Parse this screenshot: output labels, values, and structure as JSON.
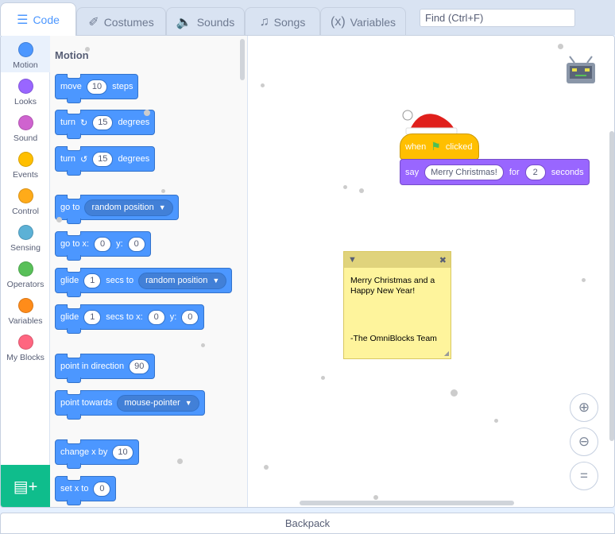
{
  "tabs": [
    {
      "label": "Code",
      "icon": "code-icon",
      "active": true
    },
    {
      "label": "Costumes",
      "icon": "brush-icon"
    },
    {
      "label": "Sounds",
      "icon": "speaker-icon"
    },
    {
      "label": "Songs",
      "icon": "music-note-icon"
    },
    {
      "label": "Variables",
      "icon": "variable-icon"
    }
  ],
  "find": {
    "placeholder": "Find (Ctrl+F)"
  },
  "categories": [
    {
      "label": "Motion",
      "color": "#4c97ff"
    },
    {
      "label": "Looks",
      "color": "#9966ff"
    },
    {
      "label": "Sound",
      "color": "#cf63cf"
    },
    {
      "label": "Events",
      "color": "#ffbf00"
    },
    {
      "label": "Control",
      "color": "#ffab19"
    },
    {
      "label": "Sensing",
      "color": "#5cb1d6"
    },
    {
      "label": "Operators",
      "color": "#59c059"
    },
    {
      "label": "Variables",
      "color": "#ff8c1a"
    },
    {
      "label": "My Blocks",
      "color": "#ff6680"
    }
  ],
  "flyout": {
    "title": "Motion",
    "blocks": {
      "move": {
        "a": "move",
        "n": "10",
        "b": "steps"
      },
      "turn_right": {
        "a": "turn",
        "n": "15",
        "b": "degrees"
      },
      "turn_left": {
        "a": "turn",
        "n": "15",
        "b": "degrees"
      },
      "goto": {
        "a": "go to",
        "dd": "random position"
      },
      "goto_xy": {
        "a": "go to x:",
        "x": "0",
        "b": "y:",
        "y": "0"
      },
      "glide_to": {
        "a": "glide",
        "n": "1",
        "b": "secs to",
        "dd": "random position"
      },
      "glide_xy": {
        "a": "glide",
        "n": "1",
        "b": "secs to x:",
        "x": "0",
        "c": "y:",
        "y": "0"
      },
      "point_dir": {
        "a": "point in direction",
        "n": "90"
      },
      "point_towards": {
        "a": "point towards",
        "dd": "mouse-pointer"
      },
      "change_x": {
        "a": "change x by",
        "n": "10"
      },
      "set_x": {
        "a": "set x to",
        "n": "0"
      }
    }
  },
  "script": {
    "hat": {
      "a": "when",
      "b": "clicked"
    },
    "say": {
      "a": "say",
      "text": "Merry Christmas!",
      "b": "for",
      "n": "2",
      "c": "seconds"
    }
  },
  "note": {
    "body": "Merry Christmas and a Happy New Year!",
    "signature": "-The OmniBlocks Team"
  },
  "backpack": {
    "label": "Backpack"
  },
  "colors": {
    "motion": "#4c97ff",
    "looks": "#9966ff",
    "events": "#ffbf00",
    "accent": "#0fbd8c"
  }
}
